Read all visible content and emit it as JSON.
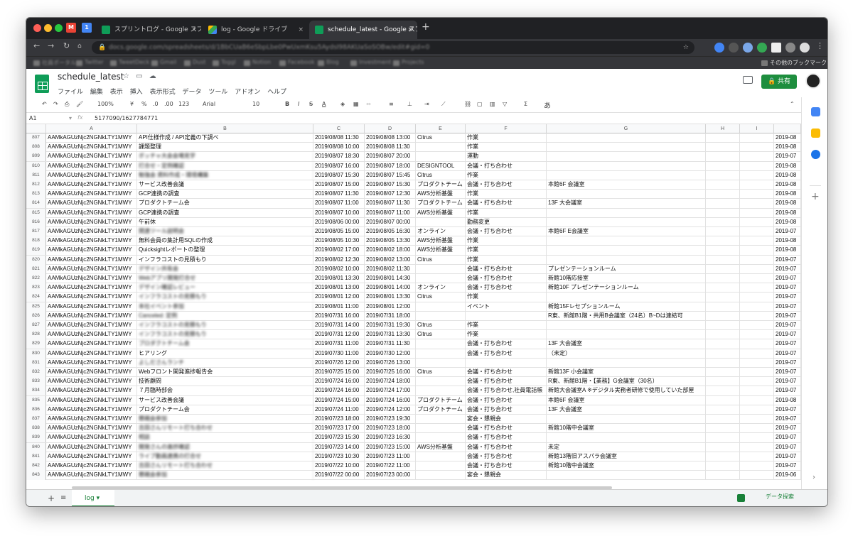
{
  "browser": {
    "tabs": [
      {
        "title": "スプリントログ - Google スプレッ",
        "active": false,
        "icon": "sheets-icon"
      },
      {
        "title": "log - Google ドライブ",
        "active": false,
        "icon": "drive-icon"
      },
      {
        "title": "schedule_latest - Google スプレ",
        "active": true,
        "icon": "sheets-icon"
      }
    ],
    "new_tab": "+",
    "close": "×",
    "url": "docs.google.com/spreadsheets/d/1BbCUaB6eSbpLbe0PwUxmKsu5AydsI98AKUaSoSOBw/edit#gid=0",
    "bookmarks": [
      "社員ポータル",
      "Twitter",
      "TweetDeck",
      "Gmail",
      "Dust",
      "Toggl",
      "Notion",
      "Facebook",
      "Blog",
      "Investment",
      "Projects"
    ],
    "other_bookmarks": "その他のブックマーク"
  },
  "sheet": {
    "title": "schedule_latest",
    "menu": [
      "ファイル",
      "編集",
      "表示",
      "挿入",
      "表示形式",
      "データ",
      "ツール",
      "アドオン",
      "ヘルプ"
    ],
    "share_label": "共有",
    "toolbar": {
      "zoom": "100%",
      "currency": "¥",
      "percent": "%",
      "decimal_less": ".0",
      "decimal_more": ".00",
      "format": "123",
      "font": "Arial",
      "size": "10",
      "bold": "B",
      "italic": "I",
      "strike": "S",
      "textcolor": "A",
      "input_tool": "あ"
    },
    "cell_ref": "A1",
    "fx": "fx",
    "formula": "5177090/1627784771",
    "columns": [
      "A",
      "B",
      "C",
      "D",
      "E",
      "F",
      "G",
      "H",
      "I"
    ],
    "rows": [
      {
        "n": "807",
        "a": "AAMkAGUzNjc2NGNkLTY1MWY",
        "b": "API仕様作成 / API定義の下調べ",
        "c": "2019/08/08 11:30",
        "d": "2019/08/08 13:00",
        "e": "Citrus",
        "f": "作業",
        "g": "",
        "j": "2019-08"
      },
      {
        "n": "808",
        "a": "AAMkAGUzNjc2NGNkLTY1MWY",
        "b": "課題整理",
        "c": "2019/08/08 10:00",
        "d": "2019/08/08 11:30",
        "e": "",
        "f": "作業",
        "g": "",
        "j": "2019-08"
      },
      {
        "n": "809",
        "a": "AAMkAGUzNjc2NGNkLTY1MWY",
        "b": "ボッチャ大会会場見学",
        "c": "2019/08/07 18:30",
        "d": "2019/08/07 20:00",
        "e": "",
        "f": "運動",
        "g": "",
        "j": "2019-07",
        "blur": true
      },
      {
        "n": "810",
        "a": "AAMkAGUzNjc2NGNkLTY1MWY",
        "b": "打合せ・定例確認",
        "c": "2019/08/07 16:00",
        "d": "2019/08/07 18:00",
        "e": "DESIGNTOOL",
        "f": "会議・打ち合わせ",
        "g": "",
        "j": "2019-08",
        "blur": true
      },
      {
        "n": "811",
        "a": "AAMkAGUzNjc2NGNkLTY1MWY",
        "b": "勉強会 資料作成・環境構築",
        "c": "2019/08/07 15:30",
        "d": "2019/08/07 15:45",
        "e": "Citrus",
        "f": "作業",
        "g": "",
        "j": "2019-08",
        "blur": true
      },
      {
        "n": "812",
        "a": "AAMkAGUzNjc2NGNkLTY1MWY",
        "b": "サービス改善会議",
        "c": "2019/08/07 15:00",
        "d": "2019/08/07 15:30",
        "e": "プロダクトチーム",
        "f": "会議・打ち合わせ",
        "g": "本館6F 会議室",
        "j": "2019-08"
      },
      {
        "n": "813",
        "a": "AAMkAGUzNjc2NGNkLTY1MWY",
        "b": "GCP連携の調査",
        "c": "2019/08/07 11:30",
        "d": "2019/08/07 12:30",
        "e": "AWS分析基盤",
        "f": "作業",
        "g": "",
        "j": "2019-08"
      },
      {
        "n": "814",
        "a": "AAMkAGUzNjc2NGNkLTY1MWY",
        "b": "プロダクトチーム会",
        "c": "2019/08/07 11:00",
        "d": "2019/08/07 11:30",
        "e": "プロダクトチーム",
        "f": "会議・打ち合わせ",
        "g": "13F 大会議室",
        "j": "2019-08"
      },
      {
        "n": "815",
        "a": "AAMkAGUzNjc2NGNkLTY1MWY",
        "b": "GCP連携の調査",
        "c": "2019/08/07 10:00",
        "d": "2019/08/07 11:00",
        "e": "AWS分析基盤",
        "f": "作業",
        "g": "",
        "j": "2019-08"
      },
      {
        "n": "816",
        "a": "AAMkAGUzNjc2NGNkLTY1MWY",
        "b": "午前休",
        "c": "2019/08/06 00:00",
        "d": "2019/08/07 00:00",
        "e": "",
        "f": "勤務変更",
        "g": "",
        "j": "2019-08"
      },
      {
        "n": "817",
        "a": "AAMkAGUzNjc2NGNkLTY1MWY",
        "b": "関連ツール説明会",
        "c": "2019/08/05 15:00",
        "d": "2019/08/05 16:30",
        "e": "オンライン",
        "f": "会議・打ち合わせ",
        "g": "本館6F E会議室",
        "j": "2019-07",
        "blur": true
      },
      {
        "n": "818",
        "a": "AAMkAGUzNjc2NGNkLTY1MWY",
        "b": "無料会員の集計用SQLの作成",
        "c": "2019/08/05 10:30",
        "d": "2019/08/05 13:30",
        "e": "AWS分析基盤",
        "f": "作業",
        "g": "",
        "j": "2019-08"
      },
      {
        "n": "819",
        "a": "AAMkAGUzNjc2NGNkLTY1MWY",
        "b": "Quicksightレポートの整理",
        "c": "2019/08/02 17:00",
        "d": "2019/08/02 18:00",
        "e": "AWS分析基盤",
        "f": "作業",
        "g": "",
        "j": "2019-08"
      },
      {
        "n": "820",
        "a": "AAMkAGUzNjc2NGNkLTY1MWY",
        "b": "インフラコストの見積もり",
        "c": "2019/08/02 12:30",
        "d": "2019/08/02 13:00",
        "e": "Citrus",
        "f": "作業",
        "g": "",
        "j": "2019-07"
      },
      {
        "n": "821",
        "a": "AAMkAGUzNjc2NGNkLTY1MWY",
        "b": "デザイン共有会",
        "c": "2019/08/02 10:00",
        "d": "2019/08/02 11:30",
        "e": "",
        "f": "会議・打ち合わせ",
        "g": "プレゼンテーションルーム",
        "j": "2019-07",
        "blur": true
      },
      {
        "n": "822",
        "a": "AAMkAGUzNjc2NGNkLTY1MWY",
        "b": "Webアプリ開発打合せ",
        "c": "2019/08/01 13:30",
        "d": "2019/08/01 14:30",
        "e": "",
        "f": "会議・打ち合わせ",
        "g": "新館10階応接室",
        "j": "2019-07",
        "blur": true
      },
      {
        "n": "823",
        "a": "AAMkAGUzNjc2NGNkLTY1MWY",
        "b": "デザイン確認レビュー",
        "c": "2019/08/01 13:00",
        "d": "2019/08/01 14:00",
        "e": "オンライン",
        "f": "会議・打ち合わせ",
        "g": "新館10F プレゼンテーションルーム",
        "j": "2019-07",
        "blur": true
      },
      {
        "n": "824",
        "a": "AAMkAGUzNjc2NGNkLTY1MWY",
        "b": "インフラコストの見積もり",
        "c": "2019/08/01 12:00",
        "d": "2019/08/01 13:30",
        "e": "Citrus",
        "f": "作業",
        "g": "",
        "j": "2019-07",
        "blur": true
      },
      {
        "n": "825",
        "a": "AAMkAGUzNjc2NGNkLTY1MWY",
        "b": "本社イベント参加",
        "c": "2019/08/01 11:00",
        "d": "2019/08/01 12:00",
        "e": "",
        "f": "イベント",
        "g": "新館15Fレセプションルーム",
        "j": "2019-07",
        "blur": true
      },
      {
        "n": "826",
        "a": "AAMkAGUzNjc2NGNkLTY1MWY",
        "b": "Canceled: 定例",
        "c": "2019/07/31 16:00",
        "d": "2019/07/31 18:00",
        "e": "",
        "f": "",
        "g": "R東、新館B1階・共用B会議室（24名）B~Dは連結可",
        "j": "2019-07",
        "blur": true
      },
      {
        "n": "827",
        "a": "AAMkAGUzNjc2NGNkLTY1MWY",
        "b": "インフラコストの見積もり",
        "c": "2019/07/31 14:00",
        "d": "2019/07/31 19:30",
        "e": "Citrus",
        "f": "作業",
        "g": "",
        "j": "2019-07",
        "blur": true
      },
      {
        "n": "828",
        "a": "AAMkAGUzNjc2NGNkLTY1MWY",
        "b": "インフラコストの見積もり",
        "c": "2019/07/31 12:00",
        "d": "2019/07/31 13:30",
        "e": "Citrus",
        "f": "作業",
        "g": "",
        "j": "2019-07",
        "blur": true
      },
      {
        "n": "829",
        "a": "AAMkAGUzNjc2NGNkLTY1MWY",
        "b": "プロダクトチーム会",
        "c": "2019/07/31 11:00",
        "d": "2019/07/31 11:30",
        "e": "",
        "f": "会議・打ち合わせ",
        "g": "13F 大会議室",
        "j": "2019-07",
        "blur": true
      },
      {
        "n": "830",
        "a": "AAMkAGUzNjc2NGNkLTY1MWY",
        "b": "ヒアリング",
        "c": "2019/07/30 11:00",
        "d": "2019/07/30 12:00",
        "e": "",
        "f": "会議・打ち合わせ",
        "g": "（未定）",
        "j": "2019-07"
      },
      {
        "n": "831",
        "a": "AAMkAGUzNjc2NGNkLTY1MWY",
        "b": "よしださんランチ",
        "c": "2019/07/26 12:00",
        "d": "2019/07/26 13:00",
        "e": "",
        "f": "",
        "g": "",
        "j": "2019-07",
        "blur": true
      },
      {
        "n": "832",
        "a": "AAMkAGUzNjc2NGNkLTY1MWY",
        "b": "Webフロント開発進捗報告会",
        "c": "2019/07/25 15:00",
        "d": "2019/07/25 16:00",
        "e": "Citrus",
        "f": "会議・打ち合わせ",
        "g": "新館13F 小会議室",
        "j": "2019-07"
      },
      {
        "n": "833",
        "a": "AAMkAGUzNjc2NGNkLTY1MWY",
        "b": "技術顧問",
        "c": "2019/07/24 16:00",
        "d": "2019/07/24 18:00",
        "e": "",
        "f": "会議・打ち合わせ",
        "g": "R東、新館B1階・【業務】G会議室（30名）",
        "j": "2019-07"
      },
      {
        "n": "834",
        "a": "AAMkAGUzNjc2NGNkLTY1MWY",
        "b": "７月臨時部会",
        "c": "2019/07/24 16:00",
        "d": "2019/07/24 17:00",
        "e": "",
        "f": "会議・打ち合わせ,社員電話帳",
        "g": "新館大会議室A ※デジタル実務者研修で使用していた部屋",
        "j": "2019-07"
      },
      {
        "n": "835",
        "a": "AAMkAGUzNjc2NGNkLTY1MWY",
        "b": "サービス改善会議",
        "c": "2019/07/24 15:00",
        "d": "2019/07/24 16:00",
        "e": "プロダクトチーム",
        "f": "会議・打ち合わせ",
        "g": "本館6F 会議室",
        "j": "2019-08"
      },
      {
        "n": "836",
        "a": "AAMkAGUzNjc2NGNkLTY1MWY",
        "b": "プロダクトチーム会",
        "c": "2019/07/24 11:00",
        "d": "2019/07/24 12:00",
        "e": "プロダクトチーム",
        "f": "会議・打ち合わせ",
        "g": "13F 大会議室",
        "j": "2019-07"
      },
      {
        "n": "837",
        "a": "AAMkAGUzNjc2NGNkLTY1MWY",
        "b": "懇親会参加",
        "c": "2019/07/23 18:00",
        "d": "2019/07/23 19:30",
        "e": "",
        "f": "宴会・懇親会",
        "g": "",
        "j": "2019-07",
        "blur": true
      },
      {
        "n": "838",
        "a": "AAMkAGUzNjc2NGNkLTY1MWY",
        "b": "吉田さんリモート打ち合わせ",
        "c": "2019/07/23 17:00",
        "d": "2019/07/23 18:00",
        "e": "",
        "f": "会議・打ち合わせ",
        "g": "新館10階中会議室",
        "j": "2019-07",
        "blur": true
      },
      {
        "n": "839",
        "a": "AAMkAGUzNjc2NGNkLTY1MWY",
        "b": "相談",
        "c": "2019/07/23 15:30",
        "d": "2019/07/23 16:30",
        "e": "",
        "f": "会議・打ち合わせ",
        "g": "",
        "j": "2019-07",
        "blur": true
      },
      {
        "n": "840",
        "a": "AAMkAGUzNjc2NGNkLTY1MWY",
        "b": "開発さんの進捗確認",
        "c": "2019/07/23 14:00",
        "d": "2019/07/23 15:00",
        "e": "AWS分析基盤",
        "f": "会議・打ち合わせ",
        "g": "未定",
        "j": "2019-07",
        "blur": true
      },
      {
        "n": "841",
        "a": "AAMkAGUzNjc2NGNkLTY1MWY",
        "b": "ライブ動画連携の打合せ",
        "c": "2019/07/23 10:30",
        "d": "2019/07/23 11:00",
        "e": "",
        "f": "会議・打ち合わせ",
        "g": "新館13階旧アスパラ会議室",
        "j": "2019-07",
        "blur": true
      },
      {
        "n": "842",
        "a": "AAMkAGUzNjc2NGNkLTY1MWY",
        "b": "吉田さんリモート打ち合わせ",
        "c": "2019/07/22 10:00",
        "d": "2019/07/22 11:00",
        "e": "",
        "f": "会議・打ち合わせ",
        "g": "新館10階中会議室",
        "j": "2019-07",
        "blur": true
      },
      {
        "n": "843",
        "a": "AAMkAGUzNjc2NGNkLTY1MWY",
        "b": "懇親会参加",
        "c": "2019/07/22 00:00",
        "d": "2019/07/23 00:00",
        "e": "",
        "f": "宴会・懇親会",
        "g": "",
        "j": "2019-06",
        "blur": true
      }
    ],
    "sheet_tab": "log",
    "explore_label": "データ探索"
  }
}
